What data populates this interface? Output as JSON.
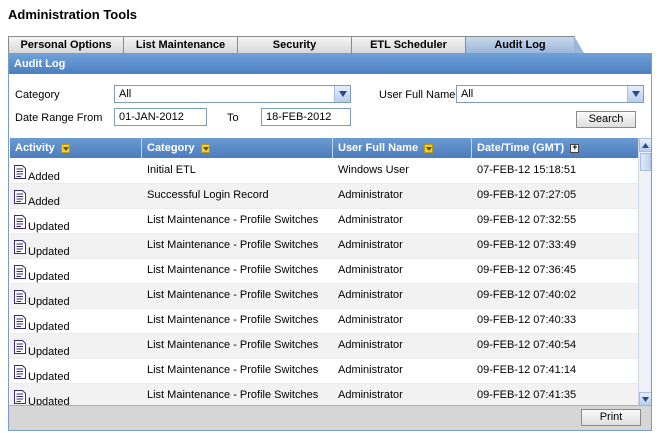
{
  "page": {
    "title": "Administration Tools"
  },
  "tabs": [
    {
      "label": "Personal Options",
      "active": false
    },
    {
      "label": "List Maintenance",
      "active": false
    },
    {
      "label": "Security",
      "active": false
    },
    {
      "label": "ETL Scheduler",
      "active": false
    },
    {
      "label": "Audit Log",
      "active": true
    }
  ],
  "panel": {
    "title": "Audit Log"
  },
  "filters": {
    "category_label": "Category",
    "category_value": "All",
    "user_label": "User Full Name",
    "user_value": "All",
    "date_from_label": "Date Range From",
    "date_from_value": "01-JAN-2012",
    "to_label": "To",
    "date_to_value": "18-FEB-2012",
    "search_label": "Search"
  },
  "grid": {
    "columns": [
      "Activity",
      "Category",
      "User Full Name",
      "Date/Time (GMT)"
    ],
    "rows": [
      {
        "activity": "Added",
        "category": "Initial ETL",
        "user": "Windows User",
        "datetime": "07-FEB-12 15:18:51"
      },
      {
        "activity": "Added",
        "category": "Successful Login Record",
        "user": "Administrator",
        "datetime": "09-FEB-12 07:27:05"
      },
      {
        "activity": "Updated",
        "category": "List Maintenance - Profile Switches",
        "user": "Administrator",
        "datetime": "09-FEB-12 07:32:55"
      },
      {
        "activity": "Updated",
        "category": "List Maintenance - Profile Switches",
        "user": "Administrator",
        "datetime": "09-FEB-12 07:33:49"
      },
      {
        "activity": "Updated",
        "category": "List Maintenance - Profile Switches",
        "user": "Administrator",
        "datetime": "09-FEB-12 07:36:45"
      },
      {
        "activity": "Updated",
        "category": "List Maintenance - Profile Switches",
        "user": "Administrator",
        "datetime": "09-FEB-12 07:40:02"
      },
      {
        "activity": "Updated",
        "category": "List Maintenance - Profile Switches",
        "user": "Administrator",
        "datetime": "09-FEB-12 07:40:33"
      },
      {
        "activity": "Updated",
        "category": "List Maintenance - Profile Switches",
        "user": "Administrator",
        "datetime": "09-FEB-12 07:40:54"
      },
      {
        "activity": "Updated",
        "category": "List Maintenance - Profile Switches",
        "user": "Administrator",
        "datetime": "09-FEB-12 07:41:14"
      },
      {
        "activity": "Updated",
        "category": "List Maintenance - Profile Switches",
        "user": "Administrator",
        "datetime": "09-FEB-12 07:41:35"
      }
    ]
  },
  "footer": {
    "print_label": "Print"
  },
  "colors": {
    "header_blue": "#4b7cbc",
    "tab_active": "#9cb6d8",
    "sort_icon": "#f0d040"
  }
}
